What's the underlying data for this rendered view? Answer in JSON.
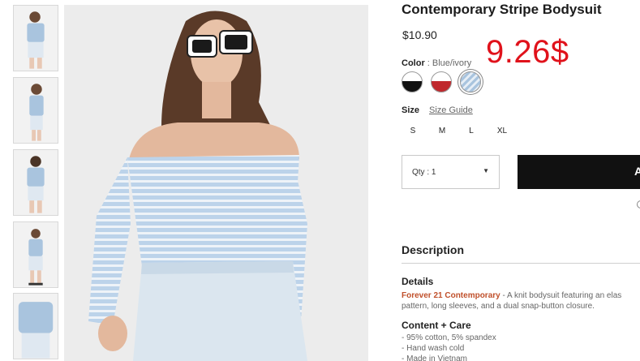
{
  "product": {
    "title": "Contemporary Stripe Bodysuit",
    "price": "$10.90",
    "annotation": "9.26$"
  },
  "color": {
    "label": "Color",
    "separator": " : ",
    "value": "Blue/ivory",
    "swatches": [
      {
        "name": "black-white",
        "top": "#ffffff",
        "bottom": "#111111"
      },
      {
        "name": "red-white",
        "top": "#ffffff",
        "bottom": "#c0282d"
      },
      {
        "name": "blue-ivory",
        "top": "#a9c4de",
        "bottom": "#dbe7f2",
        "selected": true
      }
    ]
  },
  "size": {
    "label": "Size",
    "guide": "Size Guide",
    "options": [
      "S",
      "M",
      "L",
      "XL"
    ]
  },
  "quantity": {
    "label": "Qty : 1",
    "arrow": "▼"
  },
  "cart": {
    "label": "A"
  },
  "description": {
    "heading": "Description",
    "details_heading": "Details",
    "brand": "Forever 21 Contemporary",
    "details_line1": " - A knit bodysuit featuring an elas",
    "details_line2": "pattern, long sleeves, and a dual snap-button closure.",
    "care_heading": "Content + Care",
    "care_items": [
      "- 95% cotton, 5% spandex",
      "- Hand wash cold",
      "- Made in Vietnam"
    ]
  },
  "colors": {
    "accent": "#e0121b",
    "link": "#c0502b",
    "button": "#111111"
  }
}
